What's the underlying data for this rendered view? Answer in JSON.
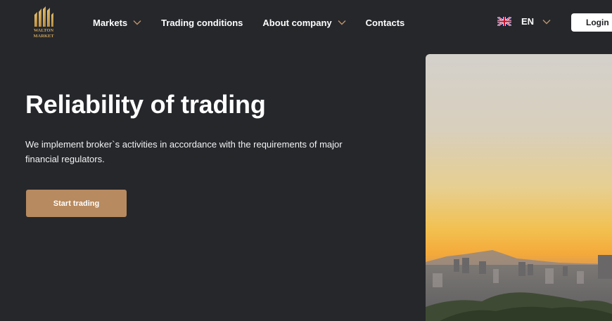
{
  "header": {
    "logo": {
      "line1": "WALTON",
      "line2": "MARKET",
      "icon": "walton-market-logo"
    },
    "nav": [
      {
        "label": "Markets",
        "has_dropdown": true
      },
      {
        "label": "Trading conditions",
        "has_dropdown": false
      },
      {
        "label": "About company",
        "has_dropdown": true
      },
      {
        "label": "Contacts",
        "has_dropdown": false
      }
    ],
    "language": {
      "code": "EN",
      "icon": "uk-flag-icon"
    },
    "login_label": "Login"
  },
  "hero": {
    "title": "Reliability of trading",
    "text": "We implement broker`s activities in accordance with the requirements of major financial regulators.",
    "cta_label": "Start trading",
    "image": "city-skyline-sunset-photo"
  },
  "colors": {
    "background": "#25272b",
    "accent": "#b78a5f",
    "logo_gold": "#c9a15a",
    "chevron": "#c29466"
  }
}
